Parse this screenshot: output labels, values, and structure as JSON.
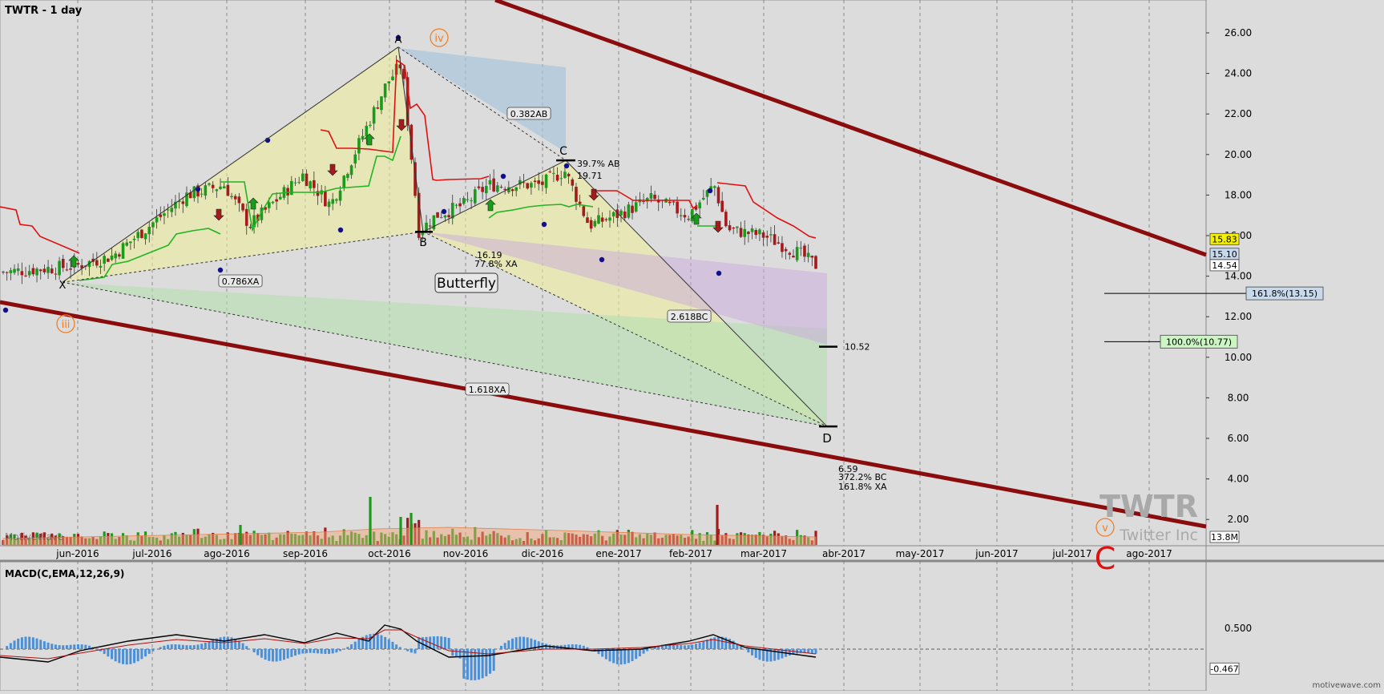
{
  "header": {
    "symbol_title": "TWTR - 1 day",
    "watermark_symbol": "TWTR",
    "watermark_name": "Twitter Inc",
    "brand_bottom": "motivewave.com",
    "brand_volume": "MotiveWave"
  },
  "price_axis": {
    "ticks": [
      {
        "v": 26,
        "label": "26.00"
      },
      {
        "v": 24,
        "label": "24.00"
      },
      {
        "v": 22,
        "label": "22.00"
      },
      {
        "v": 20,
        "label": "20.00"
      },
      {
        "v": 18,
        "label": "18.00"
      },
      {
        "v": 16,
        "label": "16.00"
      },
      {
        "v": 14,
        "label": "14.00"
      },
      {
        "v": 12,
        "label": "12.00"
      },
      {
        "v": 10,
        "label": "10.00"
      },
      {
        "v": 8,
        "label": "8.00"
      },
      {
        "v": 6,
        "label": "6.00"
      },
      {
        "v": 4,
        "label": "4.00"
      },
      {
        "v": 2,
        "label": "2.00"
      }
    ],
    "markers": [
      {
        "v": 15.83,
        "label": "15.83",
        "color": "#f5ef00"
      },
      {
        "v": 15.1,
        "label": "15.10",
        "color": "#c7d9ea"
      },
      {
        "v": 14.54,
        "label": "14.54",
        "color": "#ffffff"
      },
      {
        "v": 1.0,
        "label": "13.8M",
        "color": "#ffffff"
      }
    ]
  },
  "time_axis": {
    "labels": [
      "jun-2016",
      "jul-2016",
      "ago-2016",
      "sep-2016",
      "oct-2016",
      "nov-2016",
      "dic-2016",
      "ene-2017",
      "feb-2017",
      "mar-2017",
      "abr-2017",
      "may-2017",
      "jun-2017",
      "jul-2017",
      "ago-2017"
    ]
  },
  "macd": {
    "title": "MACD(C,EMA,12,26,9)",
    "ticks": [
      {
        "v": 0.5,
        "label": "0.500"
      }
    ],
    "marker": {
      "v": -0.467,
      "label": "-0.467"
    }
  },
  "harmonic": {
    "pattern_name": "Butterfly",
    "points": [
      {
        "name": "X",
        "label": "X"
      },
      {
        "name": "A",
        "label": "A"
      },
      {
        "name": "B",
        "label": "B",
        "price_label": "16.19",
        "ratio_label": "77.8% XA"
      },
      {
        "name": "C",
        "label": "C",
        "price_label": "19.71",
        "ratio_label": "39.7% AB"
      },
      {
        "name": "D",
        "label": "D",
        "price_label": "6.59",
        "ratio_label": "372.2% BC",
        "ratio_label2": "161.8% XA"
      }
    ],
    "ratio_tags": [
      "0.786XA",
      "0.382AB",
      "2.618BC",
      "1.618XA"
    ],
    "level_10": "10.52"
  },
  "elliott": {
    "wave_iii": "iii",
    "wave_iv": "iv",
    "wave_v": "v",
    "wave_C": "C"
  },
  "fib_targets": [
    {
      "label": "161.8%(13.15)",
      "color": "#c7d9ea"
    },
    {
      "label": "100.0%(10.77)",
      "color": "#ccf5c4"
    }
  ],
  "colors": {
    "channel": "#8b0c0c",
    "candle_up": "#1a9b1a",
    "candle_down": "#a51a1a",
    "stop_red": "#e01010",
    "stop_green": "#22b422",
    "wave_orange": "#ef7f2a",
    "macd_hist": "#4a90d9"
  },
  "chart_data": {
    "type": "candlestick",
    "title": "TWTR - 1 day",
    "ylim": [
      1.0,
      27.0
    ],
    "x_labels": [
      "jun-2016",
      "jul-2016",
      "ago-2016",
      "sep-2016",
      "oct-2016",
      "nov-2016",
      "dic-2016",
      "ene-2017",
      "feb-2017",
      "mar-2017",
      "abr-2017",
      "may-2017",
      "jun-2017",
      "jul-2017",
      "ago-2017"
    ],
    "price_path_dates": [
      "2016-05-15",
      "2016-05-31",
      "2016-06-15",
      "2016-06-30",
      "2016-07-15",
      "2016-07-31",
      "2016-08-10",
      "2016-08-31",
      "2016-09-10",
      "2016-09-30",
      "2016-10-06",
      "2016-10-13",
      "2016-10-20",
      "2016-10-31",
      "2016-11-10",
      "2016-11-30",
      "2016-12-10",
      "2016-12-20",
      "2016-12-31",
      "2017-01-15",
      "2017-01-31",
      "2017-02-10",
      "2017-02-15",
      "2017-03-01",
      "2017-03-15",
      "2017-03-22"
    ],
    "price_path_close": [
      14.2,
      14.5,
      15.0,
      16.5,
      18.0,
      18.5,
      16.5,
      19.0,
      17.5,
      23.5,
      24.5,
      16.2,
      17.0,
      17.5,
      18.5,
      18.5,
      19.2,
      16.5,
      17.0,
      17.8,
      17.0,
      18.5,
      16.3,
      16.0,
      15.1,
      14.54
    ],
    "last_close": 14.54,
    "volume_last": "13.8M",
    "harmonic_points": [
      {
        "name": "X",
        "date": "2016-05-31",
        "price": 13.7
      },
      {
        "name": "A",
        "date": "2016-10-06",
        "price": 25.3
      },
      {
        "name": "B",
        "date": "2016-10-20",
        "price": 16.19
      },
      {
        "name": "C",
        "date": "2016-12-10",
        "price": 19.71
      },
      {
        "name": "D",
        "date": "2017-03-22",
        "price": 6.59
      }
    ],
    "fib_targets": [
      {
        "label": "161.8%(13.15)",
        "price": 13.15
      },
      {
        "label": "100.0%(10.77)",
        "price": 10.77
      }
    ],
    "stop_level": 15.83,
    "macd_last": -0.467
  }
}
